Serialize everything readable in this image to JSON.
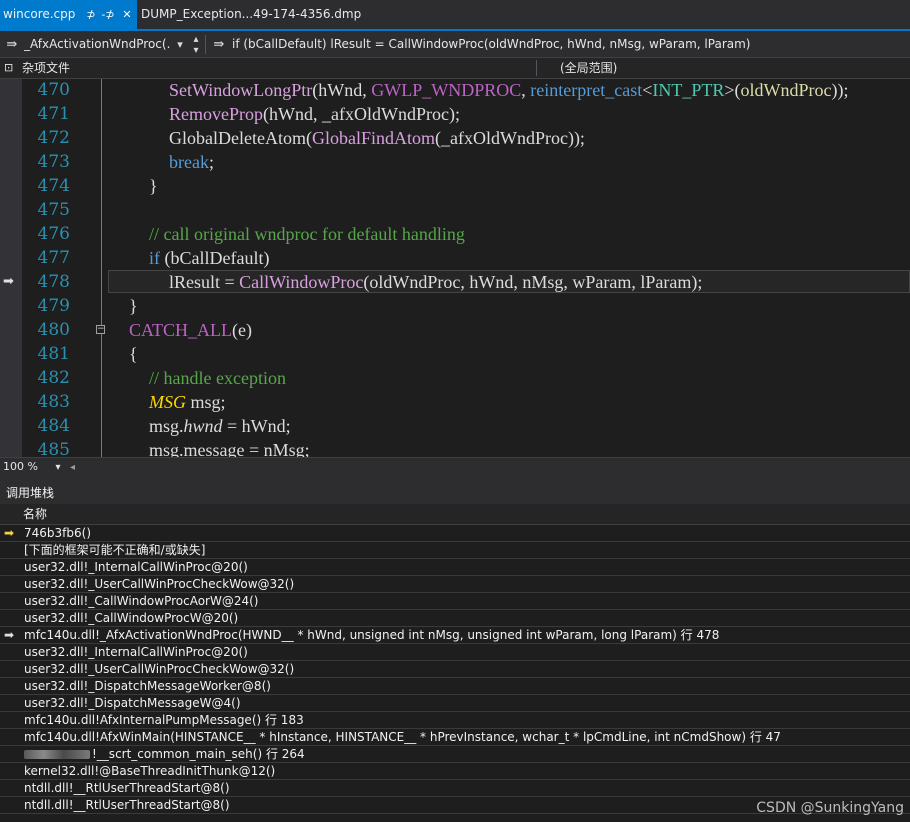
{
  "tabs": [
    {
      "label": "wincore.cpp",
      "pin": "⊅",
      "pin2": "-⊅",
      "close": "✕",
      "active": true
    },
    {
      "label": "DUMP_Exception...49-174-4356.dmp",
      "active": false
    }
  ],
  "navbar": {
    "icon": "⇛",
    "function_dropdown": "_AfxActivationWndProc(.",
    "dropdown_arrow": "▾",
    "spin_up": "▴",
    "spin_down": "▾",
    "member_icon": "⇛",
    "member_text": "if (bCallDefault) lResult = CallWindowProc(oldWndProc, hWnd, nMsg, wParam, lParam)"
  },
  "scopebar": {
    "icon": "⊡",
    "project": "杂项文件",
    "scope": "(全局范围)"
  },
  "editor": {
    "current_line": 478,
    "lines": [
      {
        "num": "470",
        "indent": 3,
        "tokens": [
          {
            "t": "SetWindowLongPtr",
            "c": "fn"
          },
          {
            "t": "(hWnd, ",
            "c": "pln"
          },
          {
            "t": "GWLP_WNDPROC",
            "c": "mac"
          },
          {
            "t": ", ",
            "c": "pln"
          },
          {
            "t": "reinterpret_cast",
            "c": "kw"
          },
          {
            "t": "<",
            "c": "pln"
          },
          {
            "t": "INT_PTR",
            "c": "ty"
          },
          {
            "t": ">(",
            "c": "pln"
          },
          {
            "t": "oldWndProc",
            "c": "cls2"
          },
          {
            "t": "));",
            "c": "pln"
          }
        ]
      },
      {
        "num": "471",
        "indent": 3,
        "tokens": [
          {
            "t": "RemoveProp",
            "c": "fn"
          },
          {
            "t": "(hWnd, _afxOldWndProc);",
            "c": "pln"
          }
        ]
      },
      {
        "num": "472",
        "indent": 3,
        "tokens": [
          {
            "t": "GlobalDeleteAtom(",
            "c": "pln"
          },
          {
            "t": "GlobalFindAtom",
            "c": "fn"
          },
          {
            "t": "(_afxOldWndProc));",
            "c": "pln"
          }
        ]
      },
      {
        "num": "473",
        "indent": 3,
        "tokens": [
          {
            "t": "break",
            "c": "kw"
          },
          {
            "t": ";",
            "c": "pln"
          }
        ]
      },
      {
        "num": "474",
        "indent": 2,
        "tokens": [
          {
            "t": "}",
            "c": "pln"
          }
        ]
      },
      {
        "num": "475",
        "indent": 0,
        "tokens": []
      },
      {
        "num": "476",
        "indent": 2,
        "tokens": [
          {
            "t": "// call original wndproc for default handling",
            "c": "cmt"
          }
        ]
      },
      {
        "num": "477",
        "indent": 2,
        "tokens": [
          {
            "t": "if",
            "c": "kw"
          },
          {
            "t": " (bCallDefault)",
            "c": "pln"
          }
        ]
      },
      {
        "num": "478",
        "indent": 3,
        "tokens": [
          {
            "t": "lResult = ",
            "c": "pln"
          },
          {
            "t": "CallWindowProc",
            "c": "fn"
          },
          {
            "t": "(oldWndProc, hWnd, nMsg, wParam, lParam);",
            "c": "pln"
          }
        ]
      },
      {
        "num": "479",
        "indent": 1,
        "tokens": [
          {
            "t": "}",
            "c": "pln"
          }
        ]
      },
      {
        "num": "480",
        "indent": 1,
        "tokens": [
          {
            "t": "CATCH_ALL",
            "c": "mac"
          },
          {
            "t": "(e)",
            "c": "pln"
          }
        ]
      },
      {
        "num": "481",
        "indent": 1,
        "tokens": [
          {
            "t": "{",
            "c": "pln"
          }
        ]
      },
      {
        "num": "482",
        "indent": 2,
        "tokens": [
          {
            "t": "// handle exception",
            "c": "cmt"
          }
        ]
      },
      {
        "num": "483",
        "indent": 2,
        "tokens": [
          {
            "t": "MSG",
            "c": "cls"
          },
          {
            "t": " msg;",
            "c": "pln"
          }
        ]
      },
      {
        "num": "484",
        "indent": 2,
        "tokens": [
          {
            "t": "msg.",
            "c": "pln"
          },
          {
            "t": "hwnd",
            "c": "fld"
          },
          {
            "t": " = hWnd;",
            "c": "pln"
          }
        ]
      },
      {
        "num": "485",
        "indent": 2,
        "tokens": [
          {
            "t": "msg.message = nMsg;",
            "c": "pln"
          }
        ]
      }
    ]
  },
  "zoom": {
    "level": "100 %",
    "arrow": "▾",
    "scroll_left": "◂"
  },
  "callstack": {
    "title": "调用堆栈",
    "column_name": "名称",
    "frames": [
      {
        "text": "746b3fb6()",
        "arrow": "current",
        "smudge": false
      },
      {
        "text": "[下面的框架可能不正确和/或缺失]",
        "arrow": "",
        "smudge": false
      },
      {
        "text": "user32.dll!_InternalCallWinProc@20()",
        "arrow": "",
        "smudge": false
      },
      {
        "text": "user32.dll!_UserCallWinProcCheckWow@32()",
        "arrow": "",
        "smudge": false
      },
      {
        "text": "user32.dll!_CallWindowProcAorW@24()",
        "arrow": "",
        "smudge": false
      },
      {
        "text": "user32.dll!_CallWindowProcW@20()",
        "arrow": "",
        "smudge": false
      },
      {
        "text": "mfc140u.dll!_AfxActivationWndProc(HWND__ * hWnd, unsigned int nMsg, unsigned int wParam, long lParam) 行 478",
        "arrow": "context",
        "smudge": false
      },
      {
        "text": "user32.dll!_InternalCallWinProc@20()",
        "arrow": "",
        "smudge": false
      },
      {
        "text": "user32.dll!_UserCallWinProcCheckWow@32()",
        "arrow": "",
        "smudge": false
      },
      {
        "text": "user32.dll!_DispatchMessageWorker@8()",
        "arrow": "",
        "smudge": false
      },
      {
        "text": "user32.dll!_DispatchMessageW@4()",
        "arrow": "",
        "smudge": false
      },
      {
        "text": "mfc140u.dll!AfxInternalPumpMessage() 行 183",
        "arrow": "",
        "smudge": false
      },
      {
        "text": "mfc140u.dll!AfxWinMain(HINSTANCE__ * hInstance, HINSTANCE__ * hPrevInstance, wchar_t * lpCmdLine, int nCmdShow) 行 47",
        "arrow": "",
        "smudge": false
      },
      {
        "text": "!__scrt_common_main_seh() 行 264",
        "arrow": "",
        "smudge": true
      },
      {
        "text": "kernel32.dll!@BaseThreadInitThunk@12()",
        "arrow": "",
        "smudge": false
      },
      {
        "text": "ntdll.dll!__RtlUserThreadStart@8()",
        "arrow": "",
        "smudge": false
      },
      {
        "text": "ntdll.dll!__RtlUserThreadStart@8()",
        "arrow": "",
        "smudge": false
      }
    ]
  },
  "watermark": "CSDN @SunkingYang",
  "margin_arrow": "➡",
  "collapse_glyph": "−",
  "colors": {
    "accent": "#007acc",
    "current_arrow": "#f5d33f",
    "context_arrow": "#e0e0e0"
  }
}
